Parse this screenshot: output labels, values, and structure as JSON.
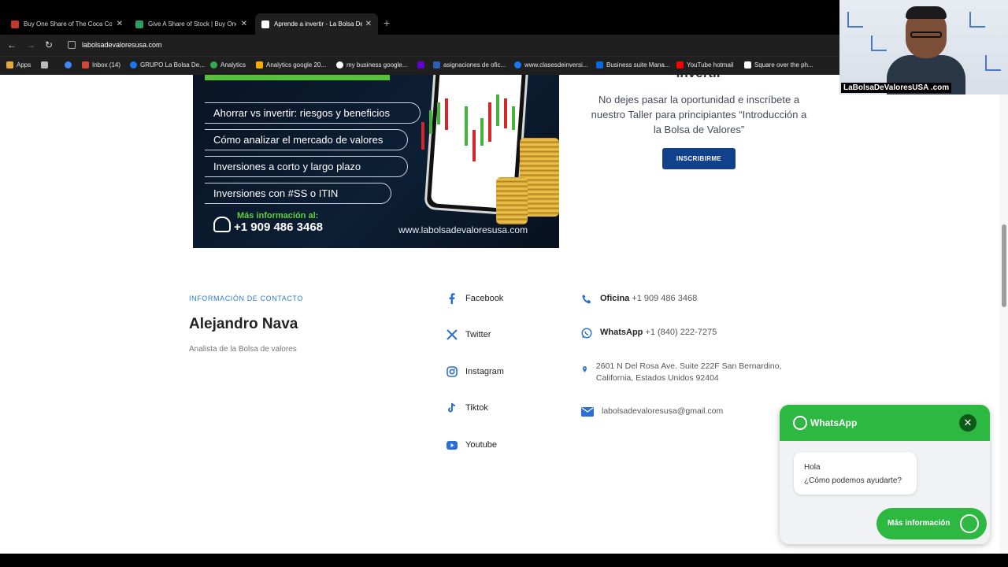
{
  "browser": {
    "tabs": [
      {
        "title": "Buy One Share of The Coca Co...",
        "active": false
      },
      {
        "title": "Give A Share of Stock | Buy One",
        "active": false
      },
      {
        "title": "Aprende a invertir - La Bolsa De",
        "active": true
      }
    ],
    "url": "labolsadevaloresusa.com",
    "bookmarks": [
      "Apps",
      "Inbox (14)",
      "GRUPO La Bolsa De...",
      "Analytics",
      "Analytics google 20...",
      "my business google...",
      "asignaciones de ofic...",
      "www.clasesdeinversi...",
      "Business suite Mana...",
      "YouTube hotmail",
      "Square over the ph..."
    ]
  },
  "banner": {
    "topics": [
      "Ahorrar vs invertir: riesgos y beneficios",
      "Cómo analizar el mercado de valores",
      "Inversiones a corto y largo plazo",
      "Inversiones con #SS o ITIN"
    ],
    "info_label": "Más información al:",
    "phone": "+1 909 486 3468",
    "website": "www.labolsadevaloresusa.com"
  },
  "promo": {
    "heading_cut": "invertir",
    "text": "No dejes pasar la oportunidad e inscríbete a nuestro Taller para principiantes “Introducción a la Bolsa de Valores”",
    "button": "INSCRIBIRME"
  },
  "contact": {
    "section_label": "INFORMACIÓN DE CONTACTO",
    "name": "Alejandro Nava",
    "role": "Analista de la Bolsa de valores",
    "social": [
      "Facebook",
      "Twitter",
      "Instagram",
      "Tiktok",
      "Youtube"
    ],
    "office_label": "Oficina",
    "office_phone": "+1 909 486 3468",
    "whatsapp_label": "WhatsApp",
    "whatsapp_phone": "+1 (840) 222-7275",
    "address": "2601 N Del Rosa Ave. Suite 222F San Bernardino, California, Estados Unidos 92404",
    "email": "labolsadevaloresusa@gmail.com"
  },
  "webcam": {
    "label": "LaBolsaDeValoresUSA .com"
  },
  "whatsapp_widget": {
    "title": "WhatsApp",
    "greeting_line1": "Hola",
    "greeting_line2": "¿Cómo podemos ayudarte?",
    "button": "Más información"
  }
}
